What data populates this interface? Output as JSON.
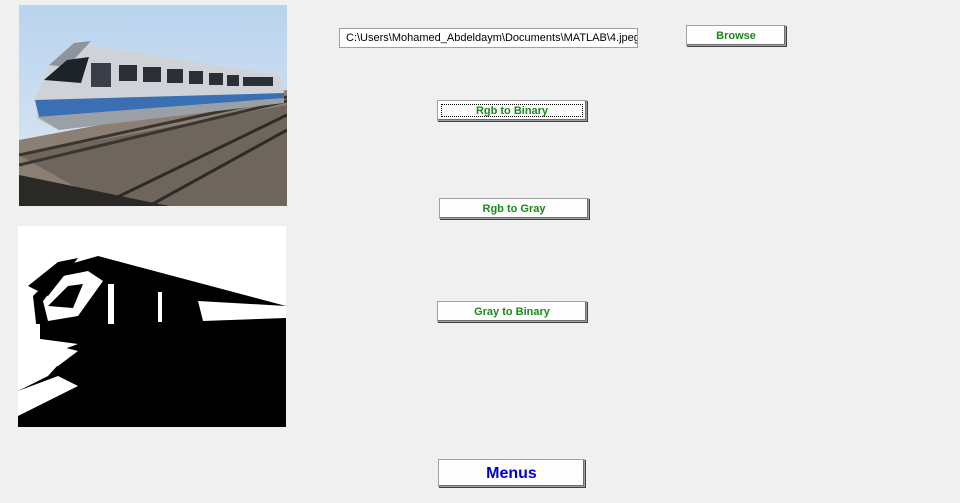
{
  "file_path": "C:\\Users\\Mohamed_Abdeldaym\\Documents\\MATLAB\\4.jpeg",
  "buttons": {
    "browse": "Browse",
    "rgb_to_binary": "Rgb to Binary",
    "rgb_to_gray": "Rgb to Gray",
    "gray_to_binary": "Gray to Binary",
    "menus": "Menus"
  },
  "colors": {
    "button_text": "#1a8a1a",
    "menus_text": "#0000cc",
    "background": "#f0f0f0"
  }
}
